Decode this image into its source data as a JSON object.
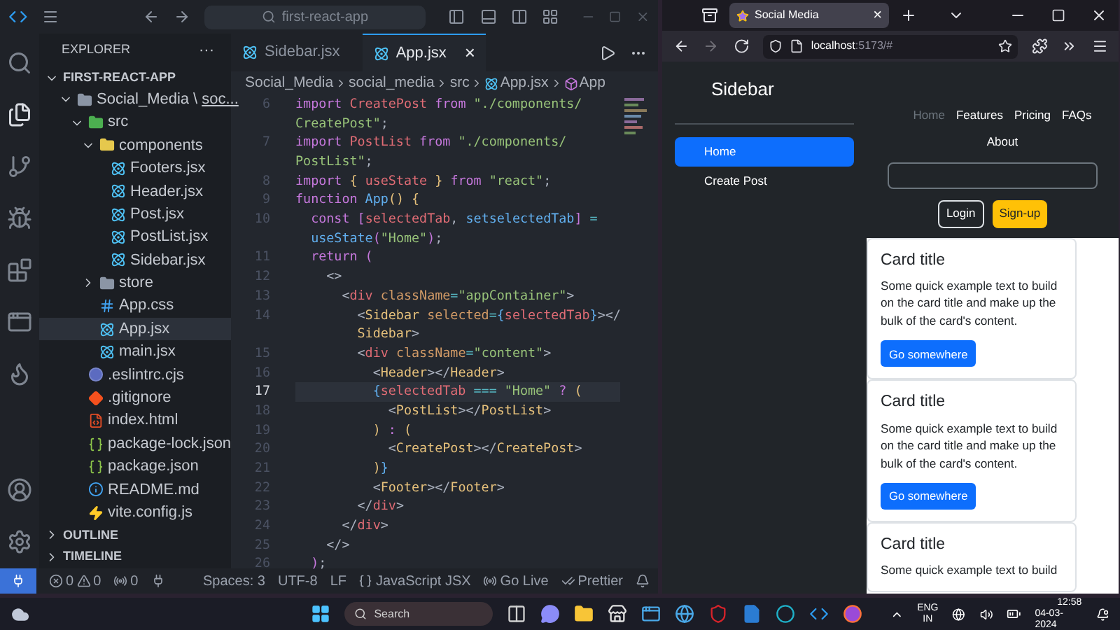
{
  "vscode": {
    "title_bar": {
      "search": "first-react-app"
    },
    "explorer": {
      "title": "EXPLORER",
      "more": "···",
      "project": {
        "label": "FIRST-REACT-APP",
        "expanded": true
      },
      "tree": [
        {
          "label": "Social_Media",
          "sep": "\\",
          "compact": "soc...",
          "kind": "folder",
          "expanded": true,
          "selected": false,
          "children": [
            {
              "label": "src",
              "kind": "src-folder",
              "expanded": true,
              "selected": false,
              "children": [
                {
                  "label": "components",
                  "kind": "components-folder",
                  "expanded": true,
                  "selected": false,
                  "children": [
                    {
                      "label": "Footers.jsx",
                      "kind": "react",
                      "selected": false
                    },
                    {
                      "label": "Header.jsx",
                      "kind": "react",
                      "selected": false
                    },
                    {
                      "label": "Post.jsx",
                      "kind": "react",
                      "selected": false
                    },
                    {
                      "label": "PostList.jsx",
                      "kind": "react",
                      "selected": false
                    },
                    {
                      "label": "Sidebar.jsx",
                      "kind": "react",
                      "selected": false
                    }
                  ]
                },
                {
                  "label": "store",
                  "kind": "folder",
                  "expanded": false,
                  "selected": false
                },
                {
                  "label": "App.css",
                  "kind": "css",
                  "selected": false
                },
                {
                  "label": "App.jsx",
                  "kind": "react",
                  "selected": true
                },
                {
                  "label": "main.jsx",
                  "kind": "react",
                  "selected": false
                }
              ]
            },
            {
              "label": ".eslintrc.cjs",
              "kind": "eslint",
              "selected": false
            },
            {
              "label": ".gitignore",
              "kind": "git",
              "selected": false
            },
            {
              "label": "index.html",
              "kind": "html",
              "selected": false
            },
            {
              "label": "package-lock.json",
              "kind": "json",
              "selected": false
            },
            {
              "label": "package.json",
              "kind": "json",
              "selected": false
            },
            {
              "label": "README.md",
              "kind": "info",
              "selected": false
            },
            {
              "label": "vite.config.js",
              "kind": "vite",
              "selected": false
            }
          ]
        }
      ],
      "sections": [
        {
          "label": "OUTLINE",
          "expanded": false
        },
        {
          "label": "TIMELINE",
          "expanded": false
        }
      ]
    },
    "tabs": [
      {
        "label": "Sidebar.jsx",
        "selected": false
      },
      {
        "label": "App.jsx",
        "selected": true,
        "close": "×"
      }
    ],
    "breadcrumb": [
      {
        "label": "Social_Media",
        "kind": "text"
      },
      {
        "label": "social_media",
        "kind": "text"
      },
      {
        "label": "src",
        "kind": "text"
      },
      {
        "label": "App.jsx",
        "kind": "react"
      },
      {
        "label": "App",
        "kind": "symbol"
      }
    ],
    "code": [
      {
        "number": "6",
        "active": false,
        "rows": [
          {
            "tokens": [
              {
                "kind": "kw",
                "text": "import "
              },
              {
                "kind": "var",
                "text": "CreatePost "
              },
              {
                "kind": "kw",
                "text": "from "
              },
              {
                "kind": "str",
                "text": "\"./components/"
              }
            ]
          },
          {
            "tokens": [
              {
                "kind": "str",
                "text": "CreatePost\""
              },
              {
                "kind": "punc",
                "text": ";"
              }
            ]
          }
        ]
      },
      {
        "number": "7",
        "active": false,
        "rows": [
          {
            "tokens": [
              {
                "kind": "kw",
                "text": "import "
              },
              {
                "kind": "var",
                "text": "PostList "
              },
              {
                "kind": "kw",
                "text": "from "
              },
              {
                "kind": "str",
                "text": "\"./components/"
              }
            ]
          },
          {
            "tokens": [
              {
                "kind": "str",
                "text": "PostList\""
              },
              {
                "kind": "punc",
                "text": ";"
              }
            ]
          }
        ]
      },
      {
        "number": "8",
        "active": false,
        "rows": [
          {
            "tokens": [
              {
                "kind": "kw",
                "text": "import "
              },
              {
                "kind": "br1",
                "text": "{ "
              },
              {
                "kind": "var",
                "text": "useState "
              },
              {
                "kind": "br1",
                "text": "} "
              },
              {
                "kind": "kw",
                "text": "from "
              },
              {
                "kind": "str",
                "text": "\"react\""
              },
              {
                "kind": "punc",
                "text": ";"
              }
            ]
          }
        ]
      },
      {
        "number": "9",
        "active": false,
        "rows": [
          {
            "tokens": [
              {
                "kind": "kw",
                "text": "function "
              },
              {
                "kind": "fn",
                "text": "App"
              },
              {
                "kind": "br1",
                "text": "() {"
              }
            ]
          }
        ]
      },
      {
        "number": "10",
        "active": false,
        "rows": [
          {
            "tokens": [
              {
                "kind": "kw",
                "text": "  const "
              },
              {
                "kind": "br2",
                "text": "["
              },
              {
                "kind": "var",
                "text": "selectedTab"
              },
              {
                "kind": "punc",
                "text": ", "
              },
              {
                "kind": "fn",
                "text": "setselectedTab"
              },
              {
                "kind": "br2",
                "text": "] "
              },
              {
                "kind": "op",
                "text": "="
              }
            ]
          },
          {
            "tokens": [
              {
                "kind": "fn",
                "text": "  useState"
              },
              {
                "kind": "br2",
                "text": "("
              },
              {
                "kind": "str",
                "text": "\"Home\""
              },
              {
                "kind": "br2",
                "text": ")"
              },
              {
                "kind": "punc",
                "text": ";"
              }
            ]
          }
        ]
      },
      {
        "number": "11",
        "active": false,
        "rows": [
          {
            "tokens": [
              {
                "kind": "kw",
                "text": "  return "
              },
              {
                "kind": "br2",
                "text": "("
              }
            ]
          }
        ]
      },
      {
        "number": "12",
        "active": false,
        "rows": [
          {
            "tokens": [
              {
                "kind": "punc",
                "text": "    <>"
              }
            ]
          }
        ]
      },
      {
        "number": "13",
        "active": false,
        "rows": [
          {
            "tokens": [
              {
                "kind": "punc",
                "text": "      <"
              },
              {
                "kind": "tag",
                "text": "div "
              },
              {
                "kind": "attr",
                "text": "className"
              },
              {
                "kind": "op",
                "text": "="
              },
              {
                "kind": "str",
                "text": "\"appContainer\""
              },
              {
                "kind": "punc",
                "text": ">"
              }
            ]
          }
        ]
      },
      {
        "number": "14",
        "active": false,
        "rows": [
          {
            "tokens": [
              {
                "kind": "punc",
                "text": "        <"
              },
              {
                "kind": "comp",
                "text": "Sidebar "
              },
              {
                "kind": "attr",
                "text": "selected"
              },
              {
                "kind": "op",
                "text": "="
              },
              {
                "kind": "fn",
                "text": "{"
              },
              {
                "kind": "var",
                "text": "selectedTab"
              },
              {
                "kind": "fn",
                "text": "}"
              },
              {
                "kind": "punc",
                "text": "></"
              }
            ]
          },
          {
            "tokens": [
              {
                "kind": "comp",
                "text": "        Sidebar"
              },
              {
                "kind": "punc",
                "text": ">"
              }
            ]
          }
        ]
      },
      {
        "number": "15",
        "active": false,
        "rows": [
          {
            "tokens": [
              {
                "kind": "punc",
                "text": "        <"
              },
              {
                "kind": "tag",
                "text": "div "
              },
              {
                "kind": "attr",
                "text": "className"
              },
              {
                "kind": "op",
                "text": "="
              },
              {
                "kind": "str",
                "text": "\"content\""
              },
              {
                "kind": "punc",
                "text": ">"
              }
            ]
          }
        ]
      },
      {
        "number": "16",
        "active": false,
        "rows": [
          {
            "tokens": [
              {
                "kind": "punc",
                "text": "          <"
              },
              {
                "kind": "comp",
                "text": "Header"
              },
              {
                "kind": "punc",
                "text": "></"
              },
              {
                "kind": "comp",
                "text": "Header"
              },
              {
                "kind": "punc",
                "text": ">"
              }
            ]
          }
        ]
      },
      {
        "number": "17",
        "active": true,
        "rows": [
          {
            "tokens": [
              {
                "kind": "fn",
                "text": "          {"
              },
              {
                "kind": "var",
                "text": "selectedTab "
              },
              {
                "kind": "op",
                "text": "=== "
              },
              {
                "kind": "str",
                "text": "\"Home\" "
              },
              {
                "kind": "kw",
                "text": "? "
              },
              {
                "kind": "br1",
                "text": "("
              }
            ]
          }
        ]
      },
      {
        "number": "18",
        "active": false,
        "rows": [
          {
            "tokens": [
              {
                "kind": "punc",
                "text": "            <"
              },
              {
                "kind": "comp",
                "text": "PostList"
              },
              {
                "kind": "punc",
                "text": "></"
              },
              {
                "kind": "comp",
                "text": "PostList"
              },
              {
                "kind": "punc",
                "text": ">"
              }
            ]
          }
        ]
      },
      {
        "number": "19",
        "active": false,
        "rows": [
          {
            "tokens": [
              {
                "kind": "br1",
                "text": "          ) "
              },
              {
                "kind": "kw",
                "text": ": "
              },
              {
                "kind": "br1",
                "text": "("
              }
            ]
          }
        ]
      },
      {
        "number": "20",
        "active": false,
        "rows": [
          {
            "tokens": [
              {
                "kind": "punc",
                "text": "            <"
              },
              {
                "kind": "comp",
                "text": "CreatePost"
              },
              {
                "kind": "punc",
                "text": "></"
              },
              {
                "kind": "comp",
                "text": "CreatePost"
              },
              {
                "kind": "punc",
                "text": ">"
              }
            ]
          }
        ]
      },
      {
        "number": "21",
        "active": false,
        "rows": [
          {
            "tokens": [
              {
                "kind": "br1",
                "text": "          )"
              },
              {
                "kind": "fn",
                "text": "}"
              }
            ]
          }
        ]
      },
      {
        "number": "22",
        "active": false,
        "rows": [
          {
            "tokens": [
              {
                "kind": "punc",
                "text": "          <"
              },
              {
                "kind": "comp",
                "text": "Footer"
              },
              {
                "kind": "punc",
                "text": "></"
              },
              {
                "kind": "comp",
                "text": "Footer"
              },
              {
                "kind": "punc",
                "text": ">"
              }
            ]
          }
        ]
      },
      {
        "number": "23",
        "active": false,
        "rows": [
          {
            "tokens": [
              {
                "kind": "punc",
                "text": "        </"
              },
              {
                "kind": "tag",
                "text": "div"
              },
              {
                "kind": "punc",
                "text": ">"
              }
            ]
          }
        ]
      },
      {
        "number": "24",
        "active": false,
        "rows": [
          {
            "tokens": [
              {
                "kind": "punc",
                "text": "      </"
              },
              {
                "kind": "tag",
                "text": "div"
              },
              {
                "kind": "punc",
                "text": ">"
              }
            ]
          }
        ]
      },
      {
        "number": "25",
        "active": false,
        "rows": [
          {
            "tokens": [
              {
                "kind": "punc",
                "text": "    </>"
              }
            ]
          }
        ]
      },
      {
        "number": "26",
        "active": false,
        "rows": [
          {
            "tokens": [
              {
                "kind": "br2",
                "text": "  )"
              },
              {
                "kind": "punc",
                "text": ";"
              }
            ]
          }
        ]
      }
    ],
    "status_bar": {
      "errors": "0",
      "warnings": "0",
      "ports": "0",
      "items": [
        "Spaces: 3",
        "UTF-8",
        "LF",
        "JavaScript JSX",
        "Go Live",
        "Prettier"
      ]
    }
  },
  "browser": {
    "tab": {
      "title": "Social Media",
      "close": "×"
    },
    "url": {
      "host": "localhost",
      "rest": ":5173/#"
    },
    "page": {
      "sidebar": {
        "title": "Sidebar",
        "nav": [
          {
            "label": "Home",
            "selected": true
          },
          {
            "label": "Create Post",
            "selected": false
          }
        ]
      },
      "header": {
        "nav": [
          {
            "label": "Home",
            "selected": true
          },
          {
            "label": "Features",
            "selected": false
          },
          {
            "label": "Pricing",
            "selected": false
          },
          {
            "label": "FAQs",
            "selected": false
          },
          {
            "label": "About",
            "selected": false
          }
        ],
        "buttons": [
          {
            "label": "Login",
            "kind": "outline"
          },
          {
            "label": "Sign-up",
            "kind": "warning"
          }
        ]
      },
      "cards": [
        {
          "title": "Card title",
          "text": "Some quick example text to build on the card title and make up the bulk of the card's content.",
          "button": "Go somewhere"
        },
        {
          "title": "Card title",
          "text": "Some quick example text to build on the card title and make up the bulk of the card's content.",
          "button": "Go somewhere"
        },
        {
          "title": "Card title",
          "text": "Some quick example text to build"
        }
      ]
    }
  },
  "taskbar": {
    "search": "Search",
    "language": "ENG",
    "region": "IN",
    "time": "12:58",
    "date": "04-03-2024"
  }
}
